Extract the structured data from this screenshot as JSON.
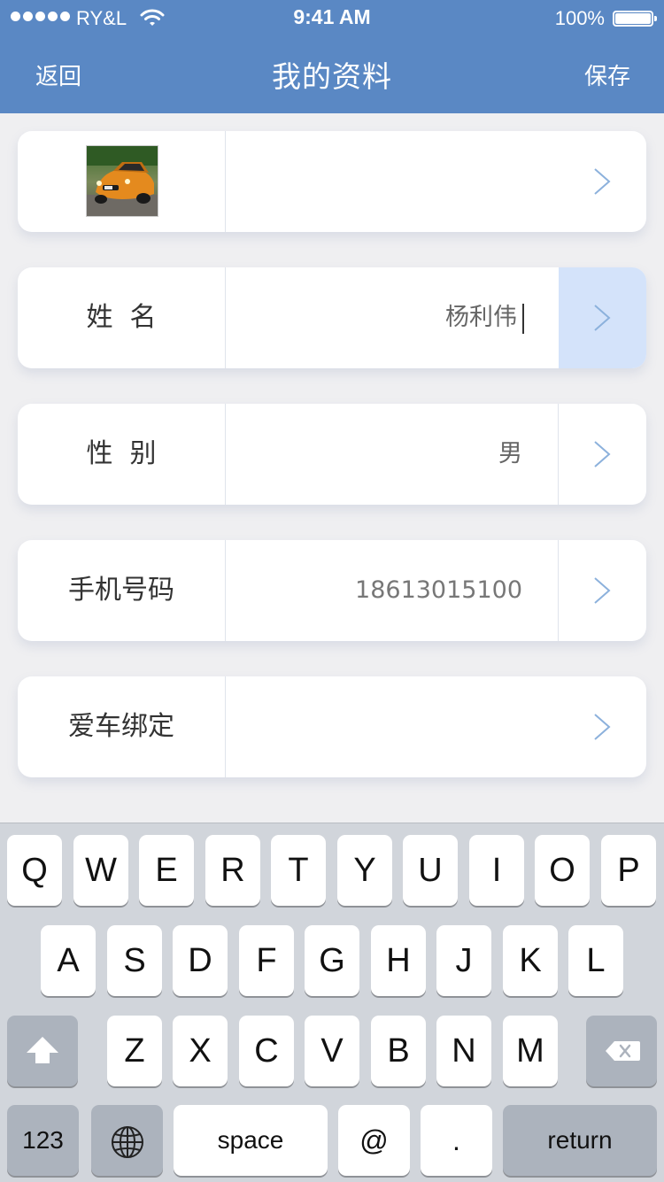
{
  "status_bar": {
    "carrier": "RY&L",
    "time": "9:41 AM",
    "battery": "100%"
  },
  "nav": {
    "back_label": "返回",
    "title": "我的资料",
    "save_label": "保存"
  },
  "profile": {
    "avatar_icon": "car-photo",
    "fields": [
      {
        "label": "姓  名",
        "value": "杨利伟",
        "focused": true
      },
      {
        "label": "性  别",
        "value": "男"
      },
      {
        "label": "手机号码",
        "value": "18613015100"
      },
      {
        "label": "爱车绑定",
        "value": ""
      }
    ]
  },
  "keyboard": {
    "row1": [
      "Q",
      "W",
      "E",
      "R",
      "T",
      "Y",
      "U",
      "I",
      "O",
      "P"
    ],
    "row2": [
      "A",
      "S",
      "D",
      "F",
      "G",
      "H",
      "J",
      "K",
      "L"
    ],
    "row3": [
      "Z",
      "X",
      "C",
      "V",
      "B",
      "N",
      "M"
    ],
    "numbers_label": "123",
    "space_label": "space",
    "at_label": "@",
    "dot_label": ".",
    "return_label": "return"
  },
  "colors": {
    "nav_bg": "#5a88c4",
    "focus_bg": "#d4e3fa",
    "keyboard_bg": "#d1d5db"
  }
}
